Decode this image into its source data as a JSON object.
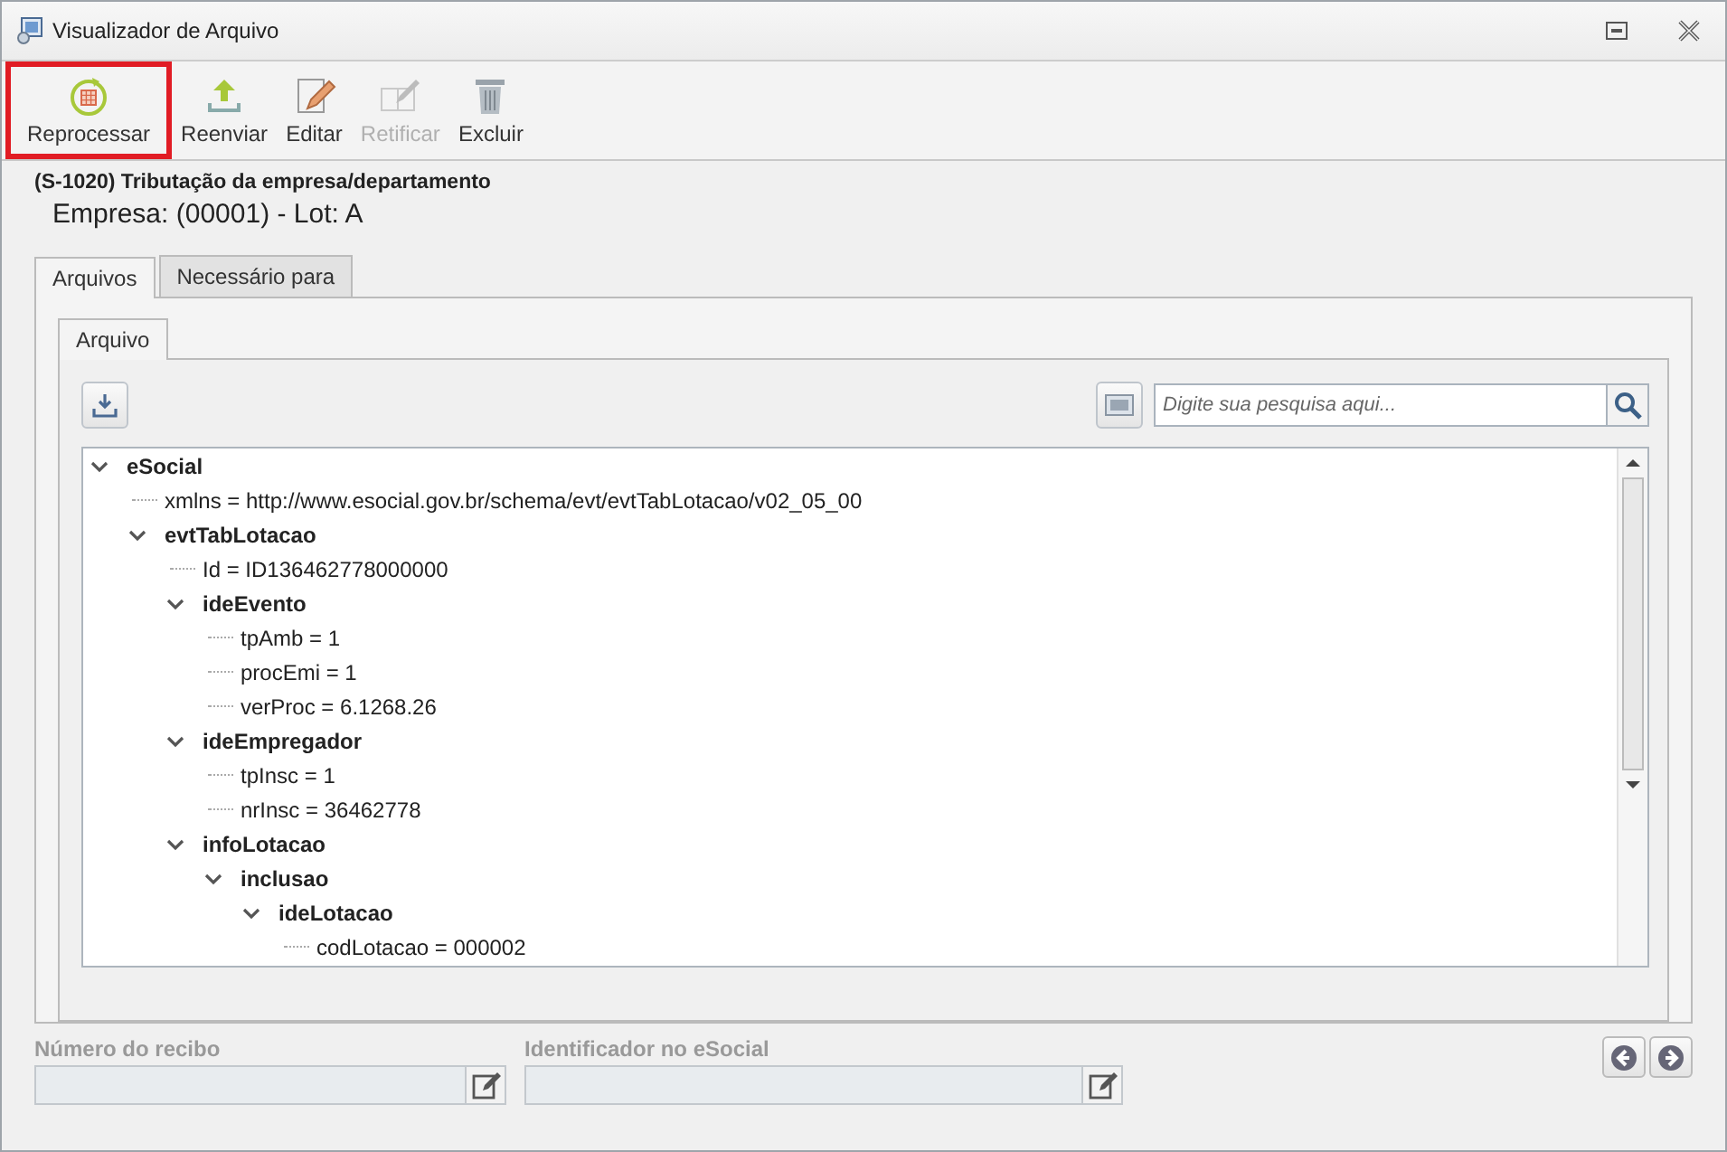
{
  "window": {
    "title": "Visualizador de Arquivo"
  },
  "toolbar": [
    {
      "label": "Reprocessar",
      "kind": "reprocess",
      "disabled": false,
      "highlighted": true
    },
    {
      "label": "Reenviar",
      "kind": "upload",
      "disabled": false,
      "highlighted": false
    },
    {
      "label": "Editar",
      "kind": "edit",
      "disabled": false,
      "highlighted": false
    },
    {
      "label": "Retificar",
      "kind": "rectify",
      "disabled": true,
      "highlighted": false
    },
    {
      "label": "Excluir",
      "kind": "delete",
      "disabled": false,
      "highlighted": false
    }
  ],
  "header": {
    "event": "(S-1020) Tributação da empresa/departamento",
    "company": "Empresa: (00001) - Lot: A"
  },
  "tabs": [
    {
      "label": "Arquivos",
      "selected": true
    },
    {
      "label": "Necessário para",
      "selected": false
    }
  ],
  "inner_tabs": [
    {
      "label": "Arquivo",
      "selected": true
    }
  ],
  "search": {
    "placeholder": "Digite sua pesquisa aqui..."
  },
  "tree": [
    {
      "label": "eSocial",
      "expanded": true,
      "children": [
        {
          "label": "xmlns = http://www.esocial.gov.br/schema/evt/evtTabLotacao/v02_05_00"
        },
        {
          "label": "evtTabLotacao",
          "expanded": true,
          "children": [
            {
              "label": "Id = ID136462778000000"
            },
            {
              "label": "ideEvento",
              "expanded": true,
              "children": [
                {
                  "label": "tpAmb = 1"
                },
                {
                  "label": "procEmi = 1"
                },
                {
                  "label": "verProc = 6.1268.26"
                }
              ]
            },
            {
              "label": "ideEmpregador",
              "expanded": true,
              "children": [
                {
                  "label": "tpInsc = 1"
                },
                {
                  "label": "nrInsc = 36462778"
                }
              ]
            },
            {
              "label": "infoLotacao",
              "expanded": true,
              "children": [
                {
                  "label": "inclusao",
                  "expanded": true,
                  "children": [
                    {
                      "label": "ideLotacao",
                      "expanded": true,
                      "children": [
                        {
                          "label": "codLotacao = 000002"
                        }
                      ]
                    }
                  ]
                }
              ]
            }
          ]
        }
      ]
    }
  ],
  "footer": {
    "fields": [
      {
        "label": "Número do recibo"
      },
      {
        "label": "Identificador no eSocial"
      }
    ]
  }
}
